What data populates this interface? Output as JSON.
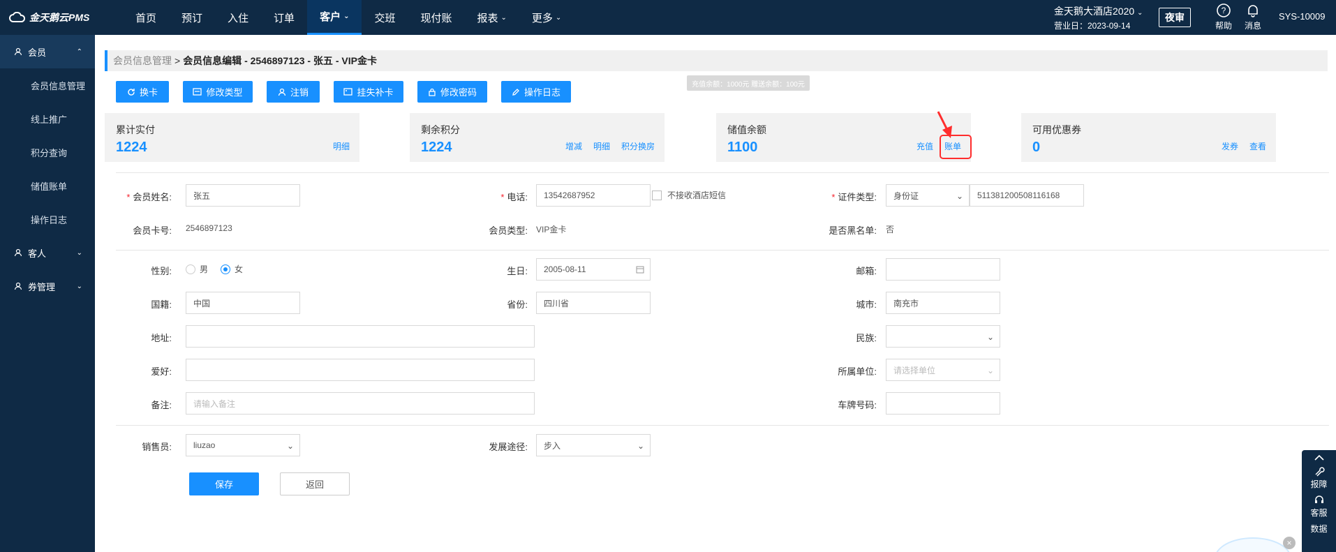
{
  "header": {
    "logo": "金天鹅云PMS",
    "nav": [
      {
        "label": "首页",
        "caret": false
      },
      {
        "label": "预订",
        "caret": false
      },
      {
        "label": "入住",
        "caret": false
      },
      {
        "label": "订单",
        "caret": false
      },
      {
        "label": "客户",
        "caret": true,
        "active": true
      },
      {
        "label": "交班",
        "caret": false
      },
      {
        "label": "现付账",
        "caret": false
      },
      {
        "label": "报表",
        "caret": true
      },
      {
        "label": "更多",
        "caret": true
      }
    ],
    "hotel_name": "金天鹅大酒店2020",
    "business_date": "营业日：2023-09-14",
    "night_audit": "夜审",
    "help": "帮助",
    "messages": "消息",
    "user": "SYS-10009"
  },
  "sidebar": {
    "groups": [
      {
        "label": "会员",
        "open": true,
        "items": [
          "会员信息管理",
          "线上推广",
          "积分查询",
          "储值账单",
          "操作日志"
        ]
      },
      {
        "label": "客人",
        "open": false,
        "items": []
      },
      {
        "label": "券管理",
        "open": false,
        "items": []
      }
    ]
  },
  "breadcrumb": {
    "parent": "会员信息管理",
    "separator": ">",
    "current": "会员信息编辑 - 2546897123 - 张五 - VIP金卡"
  },
  "actions": [
    "换卡",
    "修改类型",
    "注销",
    "挂失补卡",
    "修改密码",
    "操作日志"
  ],
  "cards": [
    {
      "title": "累计实付",
      "value": "1224",
      "links": [
        "明细"
      ]
    },
    {
      "title": "剩余积分",
      "value": "1224",
      "links": [
        "增减",
        "明细",
        "积分换房"
      ]
    },
    {
      "title": "储值余额",
      "value": "1100",
      "links": [
        "充值",
        "账单"
      ]
    },
    {
      "title": "可用优惠券",
      "value": "0",
      "links": [
        "发券",
        "查看"
      ]
    }
  ],
  "tooltip": "充值余额：1000元 赠送余额：100元",
  "form": {
    "name_label": "会员姓名:",
    "name_value": "张五",
    "phone_label": "电话:",
    "phone_value": "13542687952",
    "sms_opt_out": "不接收酒店短信",
    "id_type_label": "证件类型:",
    "id_type_value": "身份证",
    "id_number": "511381200508116168",
    "card_no_label": "会员卡号:",
    "card_no_value": "2546897123",
    "member_type_label": "会员类型:",
    "member_type_value": "VIP金卡",
    "blacklist_label": "是否黑名单:",
    "blacklist_value": "否",
    "gender_label": "性别:",
    "gender_male": "男",
    "gender_female": "女",
    "gender_selected": "女",
    "birthday_label": "生日:",
    "birthday_value": "2005-08-11",
    "email_label": "邮箱:",
    "email_value": "",
    "nationality_label": "国籍:",
    "nationality_value": "中国",
    "province_label": "省份:",
    "province_value": "四川省",
    "city_label": "城市:",
    "city_value": "南充市",
    "address_label": "地址:",
    "address_value": "",
    "ethnicity_label": "民族:",
    "ethnicity_value": "",
    "hobby_label": "爱好:",
    "hobby_value": "",
    "company_label": "所属单位:",
    "company_placeholder": "请选择单位",
    "remark_label": "备注:",
    "remark_placeholder": "请输入备注",
    "plate_label": "车牌号码:",
    "plate_value": "",
    "sales_label": "销售员:",
    "sales_value": "liuzao",
    "channel_label": "发展途径:",
    "channel_value": "步入",
    "save": "保存",
    "back": "返回"
  },
  "float_panel": {
    "report": "报障",
    "service": "客服",
    "data": "数据"
  }
}
